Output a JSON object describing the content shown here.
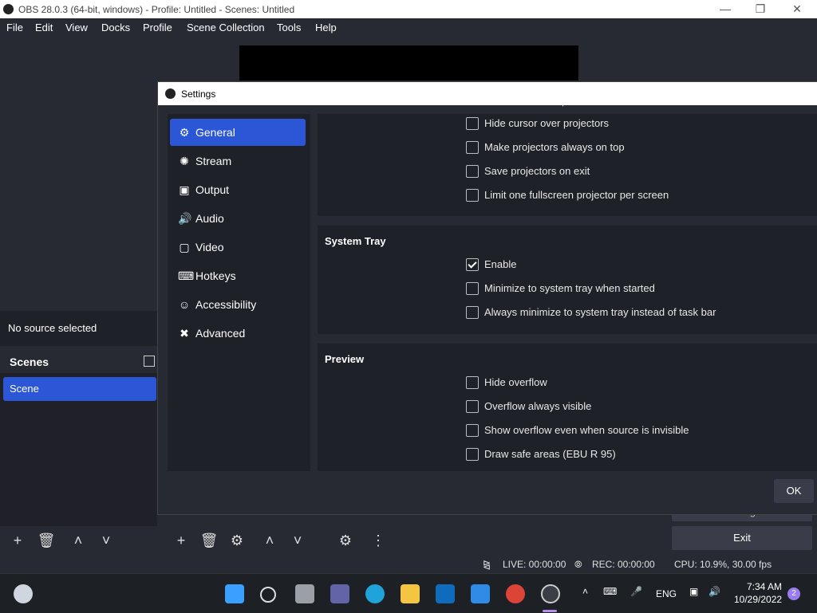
{
  "window": {
    "title": "OBS 28.0.3 (64-bit, windows) - Profile: Untitled - Scenes: Untitled",
    "minimize_icon": "minimize-icon",
    "maximize_icon": "restore-icon",
    "close_icon": "close-icon"
  },
  "menubar": {
    "items": [
      "File",
      "Edit",
      "View",
      "Docks",
      "Profile",
      "Scene Collection",
      "Tools",
      "Help"
    ]
  },
  "sources": {
    "no_source_text": "No source selected"
  },
  "scenes": {
    "header": "Scenes",
    "items": [
      "Scene"
    ]
  },
  "controls": {
    "settings_label": "Settings",
    "exit_label": "Exit"
  },
  "status": {
    "live": "LIVE: 00:00:00",
    "rec": "REC: 00:00:00",
    "cpu": "CPU: 10.9%, 30.00 fps"
  },
  "settings": {
    "title": "Settings",
    "nav": [
      {
        "label": "General",
        "icon": "gear-icon",
        "active": true
      },
      {
        "label": "Stream",
        "icon": "antenna-icon"
      },
      {
        "label": "Output",
        "icon": "output-icon"
      },
      {
        "label": "Audio",
        "icon": "speaker-icon"
      },
      {
        "label": "Video",
        "icon": "monitor-icon"
      },
      {
        "label": "Hotkeys",
        "icon": "keyboard-icon"
      },
      {
        "label": "Accessibility",
        "icon": "accessibility-icon"
      },
      {
        "label": "Advanced",
        "icon": "tools-icon"
      }
    ],
    "projectors": {
      "options": [
        {
          "label": "Hide cursor over projectors",
          "checked": false
        },
        {
          "label": "Make projectors always on top",
          "checked": false
        },
        {
          "label": "Save projectors on exit",
          "checked": false
        },
        {
          "label": "Limit one fullscreen projector per screen",
          "checked": false
        }
      ]
    },
    "system_tray": {
      "title": "System Tray",
      "options": [
        {
          "label": "Enable",
          "checked": true
        },
        {
          "label": "Minimize to system tray when started",
          "checked": false
        },
        {
          "label": "Always minimize to system tray instead of task bar",
          "checked": false
        }
      ]
    },
    "preview": {
      "title": "Preview",
      "options": [
        {
          "label": "Hide overflow",
          "checked": false
        },
        {
          "label": "Overflow always visible",
          "checked": false
        },
        {
          "label": "Show overflow even when source is invisible",
          "checked": false
        },
        {
          "label": "Draw safe areas (EBU R 95)",
          "checked": false
        }
      ]
    },
    "ok_label": "OK"
  },
  "taskbar": {
    "language": "ENG",
    "time": "7:34 AM",
    "date": "10/29/2022",
    "notifications": "2",
    "colors": {
      "start": "#3aa0ff",
      "edge": "#1fa3d8",
      "folder": "#f4c542",
      "chrome": "#db4437"
    }
  }
}
